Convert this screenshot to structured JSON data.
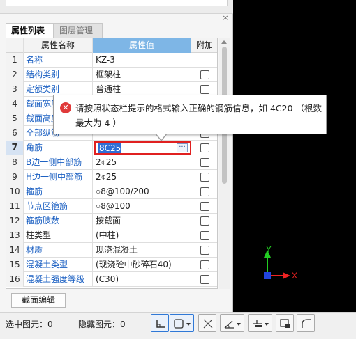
{
  "panel": {
    "tabs": [
      {
        "label": "属性列表",
        "active": true
      },
      {
        "label": "图层管理",
        "active": false
      }
    ],
    "close_glyph": "×",
    "columns": {
      "name": "属性名称",
      "value": "属性值",
      "add": "附加"
    },
    "rows": [
      {
        "num": "1",
        "name": "名称",
        "value": "KZ-3",
        "name_color": "blue",
        "has_checkbox": false
      },
      {
        "num": "2",
        "name": "结构类别",
        "value": "框架柱",
        "name_color": "blue",
        "has_checkbox": true
      },
      {
        "num": "3",
        "name": "定额类别",
        "value": "普通柱",
        "name_color": "blue",
        "has_checkbox": true
      },
      {
        "num": "4",
        "name": "截面宽度",
        "value": "",
        "name_color": "blue",
        "has_checkbox": true
      },
      {
        "num": "5",
        "name": "截面高度",
        "value": "",
        "name_color": "blue",
        "has_checkbox": true
      },
      {
        "num": "6",
        "name": "全部纵筋",
        "value": "",
        "name_color": "blue",
        "has_checkbox": true
      },
      {
        "num": "7",
        "name": "角筋",
        "value": "8C25",
        "name_color": "blue",
        "has_checkbox": true,
        "editing": true
      },
      {
        "num": "8",
        "name": "B边一侧中部筋",
        "value": "2⌽25",
        "name_color": "blue",
        "has_checkbox": true
      },
      {
        "num": "9",
        "name": "H边一侧中部筋",
        "value": "2⌽25",
        "name_color": "blue",
        "has_checkbox": true
      },
      {
        "num": "10",
        "name": "箍筋",
        "value": "⌽8@100/200",
        "name_color": "blue",
        "has_checkbox": true
      },
      {
        "num": "11",
        "name": "节点区箍筋",
        "value": "⌽8@100",
        "name_color": "blue",
        "has_checkbox": true
      },
      {
        "num": "12",
        "name": "箍筋肢数",
        "value": "按截面",
        "name_color": "blue",
        "has_checkbox": true
      },
      {
        "num": "13",
        "name": "柱类型",
        "value": "(中柱)",
        "name_color": "black",
        "has_checkbox": true
      },
      {
        "num": "14",
        "name": "材质",
        "value": "现浇混凝土",
        "name_color": "blue",
        "has_checkbox": true
      },
      {
        "num": "15",
        "name": "混凝土类型",
        "value": "(现浇砼中砂碎石40)",
        "name_color": "blue",
        "has_checkbox": true
      },
      {
        "num": "16",
        "name": "混凝土强度等级",
        "value": "(C30)",
        "name_color": "blue",
        "has_checkbox": true
      }
    ],
    "section_edit_button": "截面编辑"
  },
  "tooltip": {
    "icon": "error-icon",
    "icon_glyph": "✕",
    "message": "请按照状态栏提示的格式输入正确的钢筋信息，如 4C20 （根数最大为 4 ）"
  },
  "statusbar": {
    "selected_label": "选中图元：0",
    "hidden_label": "隐藏图元：0"
  },
  "axes": {
    "y_label": "Y",
    "x_label": "X"
  },
  "colors": {
    "header_value_bg": "#7eb6e6",
    "link_blue": "#1a5fc2",
    "edit_border": "#e02020",
    "selection_bg": "#2f6fd6",
    "error_red": "#e03a3a",
    "axis_green": "#22cc22",
    "axis_red": "#ee2222",
    "axis_blue_box": "#2244dd"
  }
}
